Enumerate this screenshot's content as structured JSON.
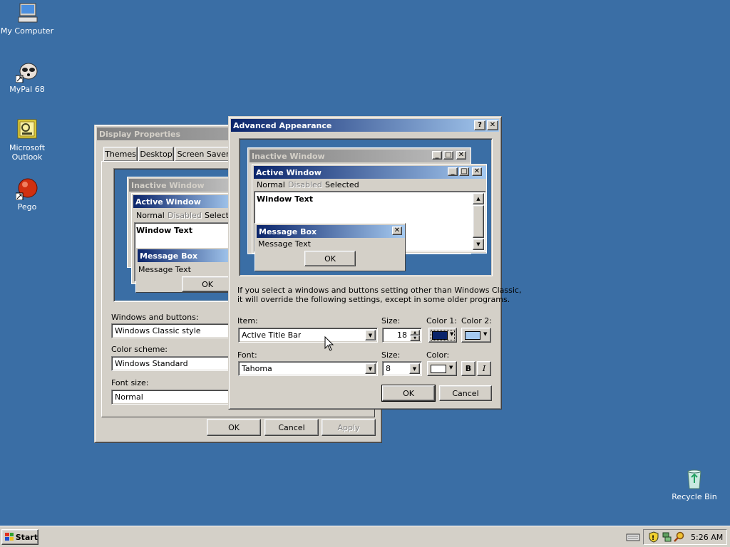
{
  "desktop": {
    "icons": [
      {
        "label": "My Computer",
        "icon": "my-computer-icon"
      },
      {
        "label": "MyPal 68",
        "icon": "raccoon-icon"
      },
      {
        "label": "Microsoft Outlook",
        "icon": "outlook-icon"
      },
      {
        "label": "Pego",
        "icon": "pego-icon"
      },
      {
        "label": "Recycle Bin",
        "icon": "recycle-bin-icon"
      }
    ],
    "background": "#3a6ea5"
  },
  "display_properties": {
    "title": "Display Properties",
    "tabs": [
      "Themes",
      "Desktop",
      "Screen Saver"
    ],
    "preview": {
      "inactive_title": "Inactive Window",
      "active_title": "Active Window",
      "menu_normal": "Normal",
      "menu_disabled": "Disabled",
      "menu_selected": "Selecte",
      "window_text": "Window Text",
      "msgbox_title": "Message Box",
      "msgbox_text": "Message Text",
      "ok": "OK"
    },
    "windows_buttons_label": "Windows and buttons:",
    "windows_buttons_value": "Windows Classic style",
    "color_scheme_label": "Color scheme:",
    "color_scheme_value": "Windows Standard",
    "font_size_label": "Font size:",
    "font_size_value": "Normal",
    "ok": "OK",
    "cancel": "Cancel",
    "apply": "Apply"
  },
  "advanced": {
    "title": "Advanced Appearance",
    "help": "?",
    "close": "✕",
    "preview": {
      "inactive_title": "Inactive Window",
      "active_title": "Active Window",
      "menu_normal": "Normal",
      "menu_disabled": "Disabled",
      "menu_selected": "Selected",
      "window_text": "Window Text",
      "msgbox_title": "Message Box",
      "msgbox_text": "Message Text",
      "ok": "OK"
    },
    "info_line1": "If you select a windows and buttons setting other than Windows Classic,",
    "info_line2": "it will override the following settings, except in some older programs.",
    "item_label": "Item:",
    "item_value": "Active Title Bar",
    "size_label": "Size:",
    "size_value": "18",
    "color1_label": "Color 1:",
    "color2_label": "Color 2:",
    "color1": "#0a246a",
    "color2": "#a6caf0",
    "font_label": "Font:",
    "font_value": "Tahoma",
    "font_size_label": "Size:",
    "font_size_value": "8",
    "font_color_label": "Color:",
    "font_color": "#ffffff",
    "bold": "B",
    "italic": "I",
    "ok": "OK",
    "cancel": "Cancel"
  },
  "taskbar": {
    "start": "Start",
    "clock": "5:26 AM"
  }
}
